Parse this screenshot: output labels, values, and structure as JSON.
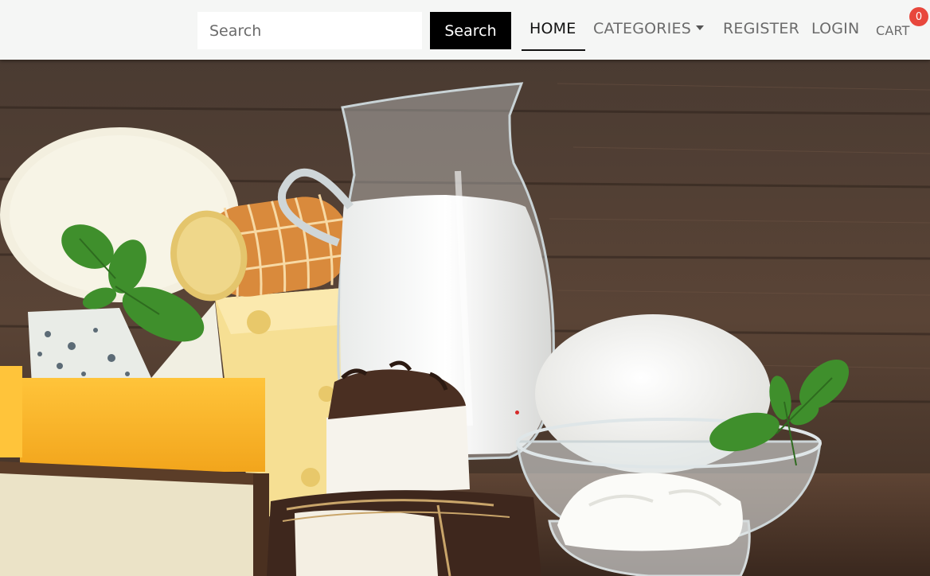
{
  "search": {
    "placeholder": "Search",
    "button_label": "Search"
  },
  "nav": {
    "home": "HOME",
    "categories": "CATEGORIES",
    "register": "REGISTER",
    "login": "LOGIN",
    "cart": "CART",
    "cart_count": "0"
  },
  "colors": {
    "navbar_bg": "#f5f6f5",
    "badge": "#e8473c",
    "button_bg": "#000000"
  },
  "hero": {
    "icon": "dairy-products-image"
  }
}
